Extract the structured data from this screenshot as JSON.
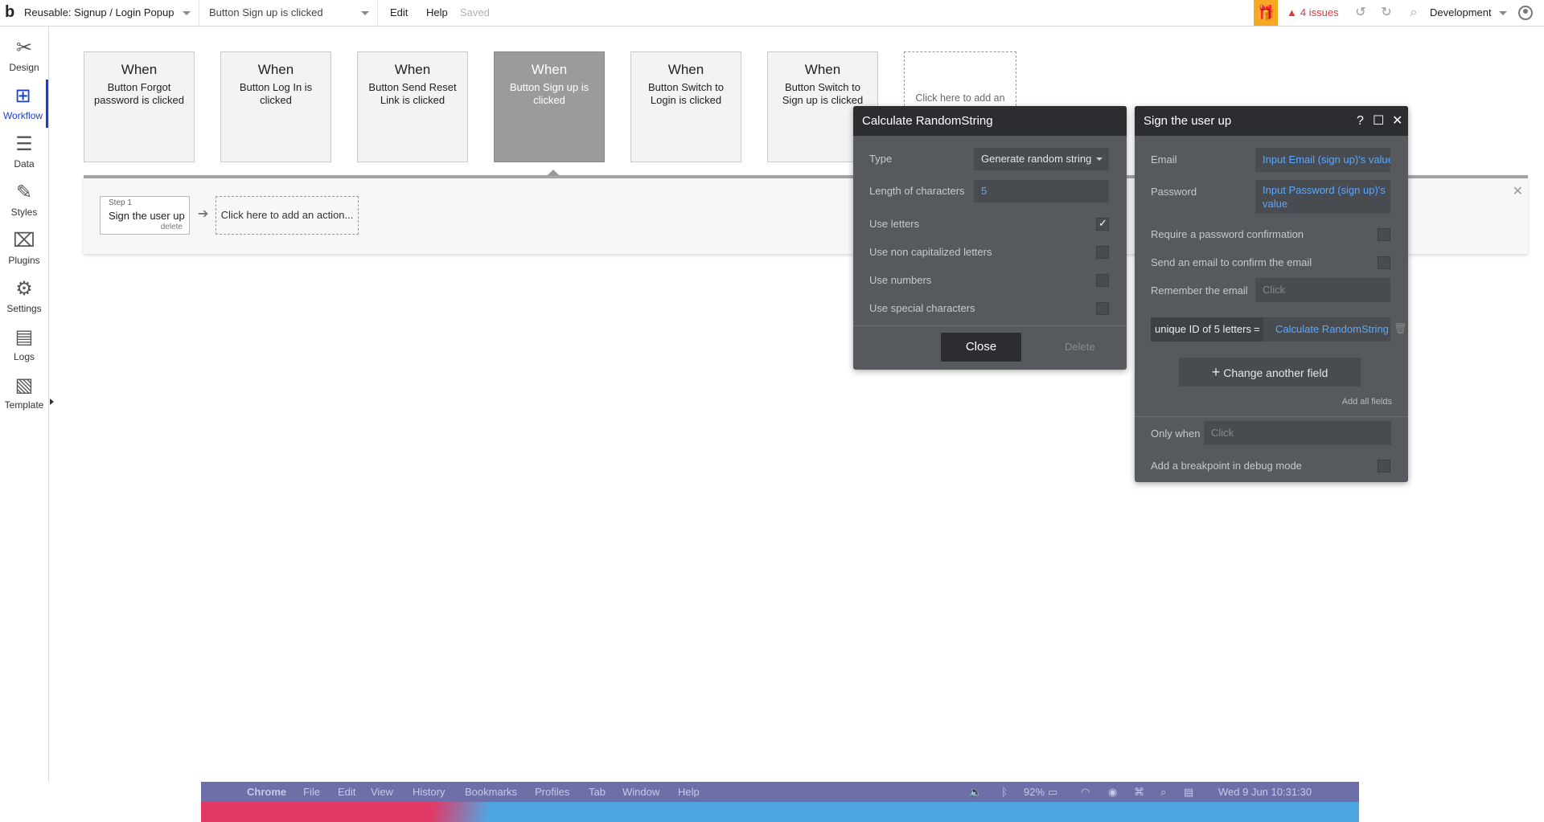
{
  "topbar": {
    "logo": "b",
    "page_selector": "Reusable: Signup / Login Popup",
    "workflow_selector": "Button Sign up is clicked",
    "menu_edit": "Edit",
    "menu_help": "Help",
    "saved": "Saved",
    "issues": "4 issues",
    "environment": "Development"
  },
  "sidebar": {
    "items": [
      {
        "label": "Design",
        "icon": "design-icon"
      },
      {
        "label": "Workflow",
        "icon": "workflow-icon",
        "active": true
      },
      {
        "label": "Data",
        "icon": "database-icon"
      },
      {
        "label": "Styles",
        "icon": "brush-icon"
      },
      {
        "label": "Plugins",
        "icon": "plugin-icon"
      },
      {
        "label": "Settings",
        "icon": "gear-icon"
      },
      {
        "label": "Logs",
        "icon": "logs-icon"
      },
      {
        "label": "Template",
        "icon": "template-icon"
      }
    ]
  },
  "events": [
    {
      "when": "When",
      "desc": "Button Forgot password is clicked"
    },
    {
      "when": "When",
      "desc": "Button Log In is clicked"
    },
    {
      "when": "When",
      "desc": "Button Send Reset Link is clicked"
    },
    {
      "when": "When",
      "desc": "Button Sign up is clicked",
      "selected": true
    },
    {
      "when": "When",
      "desc": "Button Switch to Login is clicked"
    },
    {
      "when": "When",
      "desc": "Button Switch to Sign up is clicked"
    }
  ],
  "event_add": "Click here to add an",
  "actions": {
    "step_number": "Step 1",
    "step_name": "Sign the user up",
    "step_delete": "delete",
    "add_action": "Click here to add an action..."
  },
  "random_panel": {
    "title": "Calculate RandomString",
    "type_label": "Type",
    "type_value": "Generate random string",
    "length_label": "Length of characters",
    "length_value": "5",
    "use_letters": "Use letters",
    "use_letters_checked": true,
    "use_non_cap": "Use non capitalized letters",
    "use_numbers": "Use numbers",
    "use_special": "Use special characters",
    "close": "Close",
    "delete": "Delete"
  },
  "signup_panel": {
    "title": "Sign the user up",
    "email_label": "Email",
    "email_value": "Input Email (sign up)'s value",
    "password_label": "Password",
    "password_value_1": "Input Password (sign up)'s",
    "password_value_2": "value",
    "require_confirm": "Require a password confirmation",
    "send_email": "Send an email to confirm the email",
    "remember_email": "Remember the email",
    "remember_placeholder": "Click",
    "field_key": "unique ID of 5 letters",
    "field_eq": "=",
    "field_value": "Calculate RandomString",
    "change_field": "Change another field",
    "add_all": "Add all fields",
    "only_when": "Only when",
    "only_when_placeholder": "Click",
    "breakpoint": "Add a breakpoint in debug mode"
  },
  "macos_menu": {
    "items": [
      "Chrome",
      "File",
      "Edit",
      "View",
      "History",
      "Bookmarks",
      "Profiles",
      "Tab",
      "Window",
      "Help"
    ],
    "battery": "92%",
    "datetime": "Wed 9 Jun  10:31:30"
  }
}
